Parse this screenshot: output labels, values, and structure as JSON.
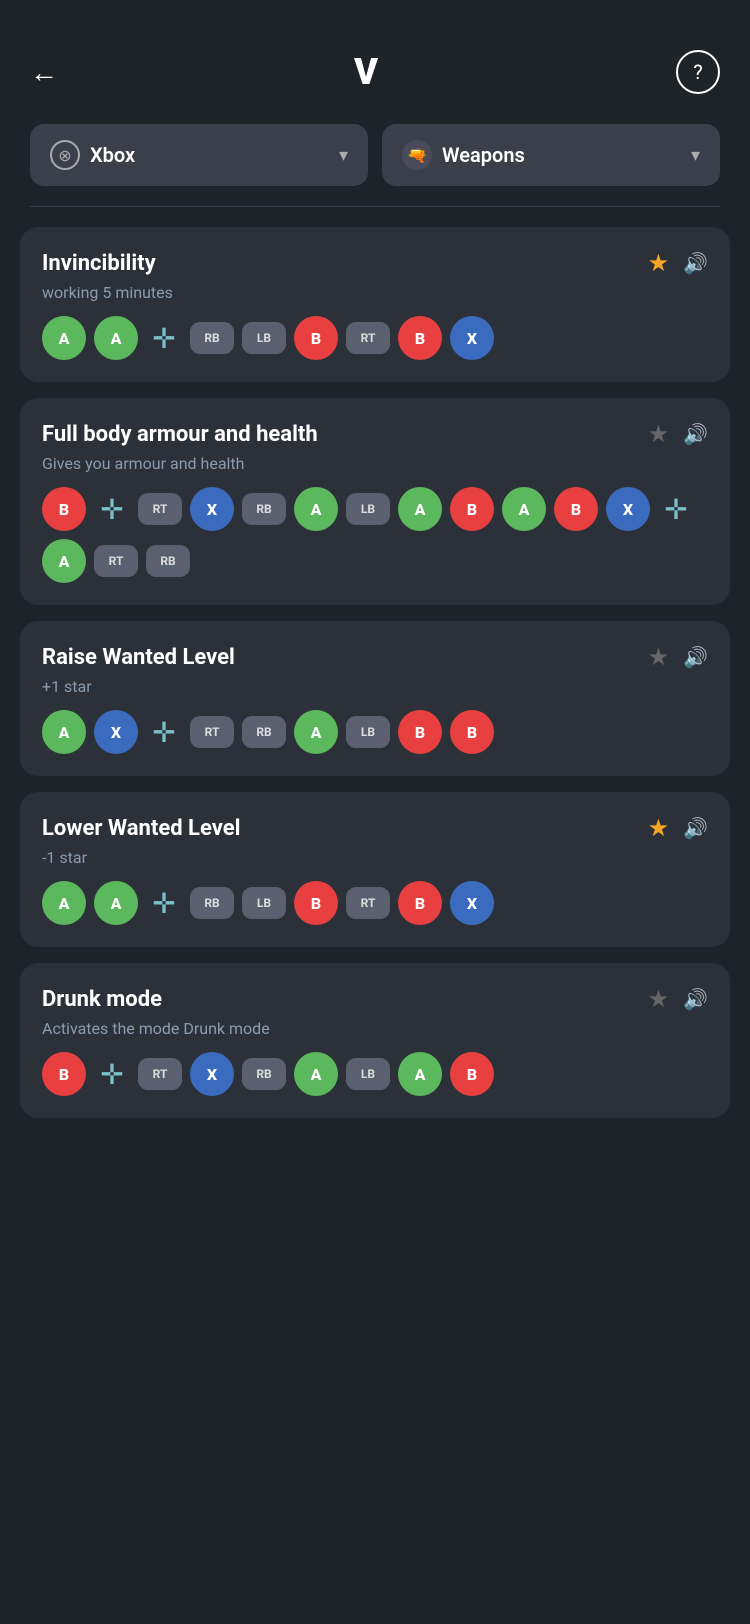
{
  "header": {
    "title": "V",
    "back_label": "←",
    "help_label": "?"
  },
  "filters": [
    {
      "id": "platform",
      "icon": "xbox",
      "label": "Xbox",
      "has_chevron": true
    },
    {
      "id": "category",
      "icon": "gun",
      "label": "Weapons",
      "has_chevron": true
    }
  ],
  "cheats": [
    {
      "id": "invincibility",
      "title": "Invincibility",
      "subtitle": "working 5 minutes",
      "starred": true,
      "buttons": [
        "A",
        "A",
        "dpad-down",
        "RB",
        "LB",
        "B",
        "RT",
        "B",
        "X"
      ]
    },
    {
      "id": "full-body-armour",
      "title": "Full body armour and health",
      "subtitle": "Gives you armour and health",
      "starred": false,
      "buttons": [
        "B",
        "dpad-down",
        "RT",
        "X",
        "RB",
        "A",
        "LB",
        "A",
        "B",
        "A",
        "B",
        "X",
        "dpad-down",
        "A",
        "RT",
        "RB"
      ]
    },
    {
      "id": "raise-wanted",
      "title": "Raise Wanted Level",
      "subtitle": "+1 star",
      "starred": false,
      "buttons": [
        "A",
        "X",
        "dpad-down",
        "RT",
        "RB",
        "A",
        "LB",
        "B",
        "B"
      ]
    },
    {
      "id": "lower-wanted",
      "title": "Lower Wanted Level",
      "subtitle": "-1 star",
      "starred": true,
      "buttons": [
        "A",
        "A",
        "dpad-down",
        "RB",
        "LB",
        "B",
        "RT",
        "B",
        "X"
      ]
    },
    {
      "id": "drunk-mode",
      "title": "Drunk mode",
      "subtitle": "Activates the mode Drunk mode",
      "starred": false,
      "buttons": [
        "B",
        "dpad-down",
        "RT",
        "X",
        "RB",
        "A",
        "LB",
        "A",
        "B"
      ]
    }
  ]
}
